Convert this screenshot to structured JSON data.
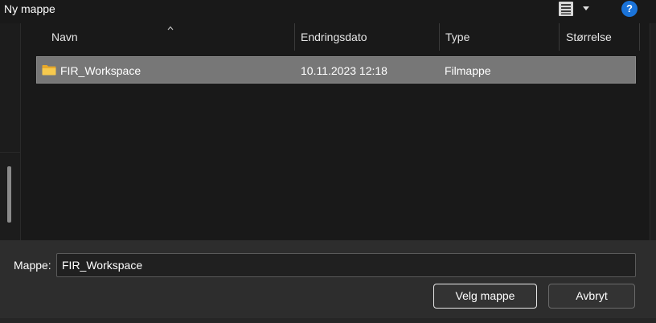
{
  "toolbar": {
    "new_folder_label": "Ny mappe",
    "view_icon": "view-details-icon",
    "help_label": "?"
  },
  "columns": {
    "name": "Navn",
    "date": "Endringsdato",
    "type": "Type",
    "size": "Størrelse"
  },
  "files": [
    {
      "name": "FIR_Workspace",
      "date": "10.11.2023 12:18",
      "type": "Filmappe",
      "size": "",
      "icon": "folder-icon",
      "selected": true
    }
  ],
  "footer": {
    "folder_label": "Mappe:",
    "folder_value": "FIR_Workspace",
    "select_button": "Velg mappe",
    "cancel_button": "Avbryt"
  },
  "colors": {
    "background": "#191919",
    "selection": "#777777",
    "footer": "#2d2d2d",
    "accent": "#1a73d9",
    "folder": "#f3c34a"
  }
}
